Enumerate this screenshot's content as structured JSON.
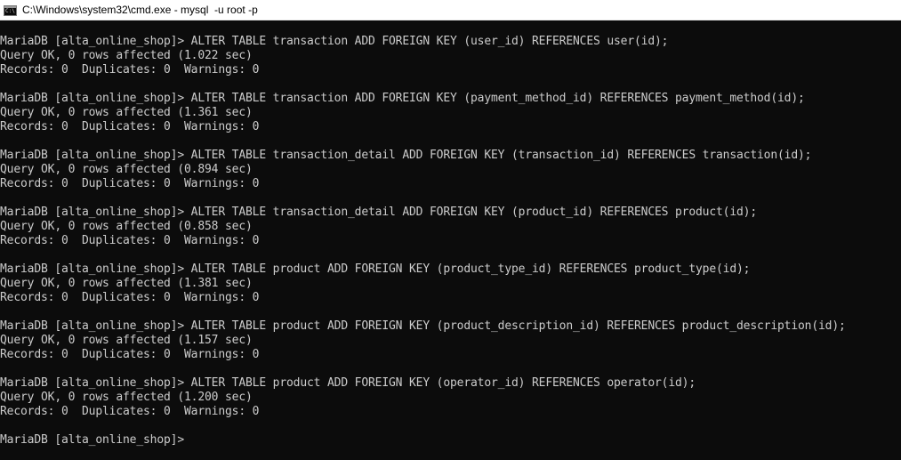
{
  "window": {
    "title": "C:\\Windows\\system32\\cmd.exe - mysql  -u root -p",
    "icon": "cmd-icon",
    "icon_glyph": "C:\\"
  },
  "colors": {
    "background": "#0c0c0c",
    "text": "#cccccc",
    "titlebar": "#ffffff"
  },
  "console": {
    "blocks": [
      {
        "command": "MariaDB [alta_online_shop]> ALTER TABLE transaction ADD FOREIGN KEY (user_id) REFERENCES user(id);",
        "result": "Query OK, 0 rows affected (1.022 sec)",
        "records": "Records: 0  Duplicates: 0  Warnings: 0"
      },
      {
        "command": "MariaDB [alta_online_shop]> ALTER TABLE transaction ADD FOREIGN KEY (payment_method_id) REFERENCES payment_method(id);",
        "result": "Query OK, 0 rows affected (1.361 sec)",
        "records": "Records: 0  Duplicates: 0  Warnings: 0"
      },
      {
        "command": "MariaDB [alta_online_shop]> ALTER TABLE transaction_detail ADD FOREIGN KEY (transaction_id) REFERENCES transaction(id);",
        "result": "Query OK, 0 rows affected (0.894 sec)",
        "records": "Records: 0  Duplicates: 0  Warnings: 0"
      },
      {
        "command": "MariaDB [alta_online_shop]> ALTER TABLE transaction_detail ADD FOREIGN KEY (product_id) REFERENCES product(id);",
        "result": "Query OK, 0 rows affected (0.858 sec)",
        "records": "Records: 0  Duplicates: 0  Warnings: 0"
      },
      {
        "command": "MariaDB [alta_online_shop]> ALTER TABLE product ADD FOREIGN KEY (product_type_id) REFERENCES product_type(id);",
        "result": "Query OK, 0 rows affected (1.381 sec)",
        "records": "Records: 0  Duplicates: 0  Warnings: 0"
      },
      {
        "command": "MariaDB [alta_online_shop]> ALTER TABLE product ADD FOREIGN KEY (product_description_id) REFERENCES product_description(id);",
        "result": "Query OK, 0 rows affected (1.157 sec)",
        "records": "Records: 0  Duplicates: 0  Warnings: 0"
      },
      {
        "command": "MariaDB [alta_online_shop]> ALTER TABLE product ADD FOREIGN KEY (operator_id) REFERENCES operator(id);",
        "result": "Query OK, 0 rows affected (1.200 sec)",
        "records": "Records: 0  Duplicates: 0  Warnings: 0"
      }
    ],
    "prompt": "MariaDB [alta_online_shop]> "
  }
}
